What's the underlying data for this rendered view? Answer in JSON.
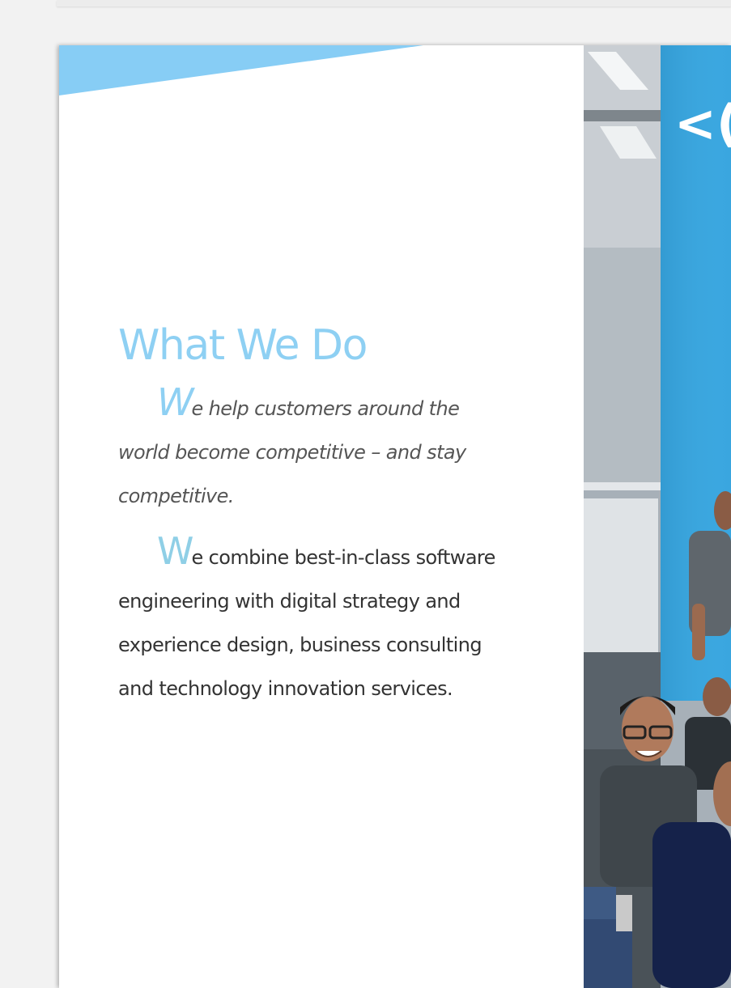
{
  "document": {
    "section_title": "What We Do",
    "paragraph_1": {
      "initial": "W",
      "rest": "e help customers around the world become competitive – and stay competitive."
    },
    "paragraph_2": {
      "initial": "W",
      "rest": "e combine best-in-class software engineering with digital strategy and experience design, business consulting and technology innovation services."
    }
  },
  "photo": {
    "wall_sign_fragment": "<("
  },
  "colors": {
    "accent_light_blue": "#8ed0f3",
    "banner_blue": "#87cdf5",
    "wall_blue": "#3aa6df",
    "page_background": "#ffffff",
    "viewer_background": "#f2f2f2"
  }
}
